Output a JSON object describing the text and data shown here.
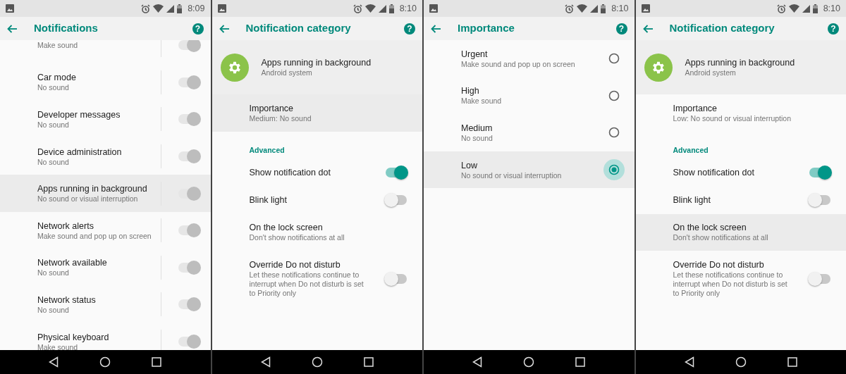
{
  "screens": [
    {
      "status_bar": {
        "time": "8:09"
      },
      "app_bar": {
        "title": "Notifications",
        "help": "?"
      },
      "items": [
        {
          "kind": "split_switch",
          "subtitle": "Make sound",
          "on": true,
          "disabled": true,
          "selected": false
        },
        {
          "kind": "split_switch",
          "title": "Car mode",
          "subtitle": "No sound",
          "on": true,
          "disabled": true,
          "selected": false
        },
        {
          "kind": "split_switch",
          "title": "Developer messages",
          "subtitle": "No sound",
          "on": true,
          "disabled": true,
          "selected": false
        },
        {
          "kind": "split_switch",
          "title": "Device administration",
          "subtitle": "No sound",
          "on": true,
          "disabled": true,
          "selected": false
        },
        {
          "kind": "split_switch",
          "title": "Apps running in background",
          "subtitle": "No sound or visual interruption",
          "on": true,
          "disabled": true,
          "selected": true
        },
        {
          "kind": "split_switch",
          "title": "Network alerts",
          "subtitle": "Make sound and pop up on screen",
          "on": true,
          "disabled": true,
          "selected": false
        },
        {
          "kind": "split_switch",
          "title": "Network available",
          "subtitle": "No sound",
          "on": true,
          "disabled": true,
          "selected": false
        },
        {
          "kind": "split_switch",
          "title": "Network status",
          "subtitle": "No sound",
          "on": true,
          "disabled": true,
          "selected": false
        },
        {
          "kind": "split_switch",
          "title": "Physical keyboard",
          "subtitle": "Make sound",
          "on": true,
          "disabled": true,
          "selected": false
        }
      ]
    },
    {
      "status_bar": {
        "time": "8:10"
      },
      "app_bar": {
        "title": "Notification category",
        "help": "?"
      },
      "header": {
        "title": "Apps running in background",
        "subtitle": "Android system"
      },
      "items": [
        {
          "kind": "text",
          "title": "Importance",
          "subtitle": "Medium: No sound",
          "selected": true
        },
        {
          "kind": "section",
          "title": "Advanced"
        },
        {
          "kind": "switch",
          "title": "Show notification dot",
          "on": true,
          "disabled": false,
          "selected": false
        },
        {
          "kind": "switch",
          "title": "Blink light",
          "on": false,
          "disabled": false,
          "selected": false
        },
        {
          "kind": "text",
          "title": "On the lock screen",
          "subtitle": "Don't show notifications at all",
          "selected": false
        },
        {
          "kind": "switch",
          "title": "Override Do not disturb",
          "subtitle": "Let these notifications continue to interrupt when Do not disturb is set to Priority only",
          "on": false,
          "disabled": false,
          "selected": false
        }
      ]
    },
    {
      "status_bar": {
        "time": "8:10"
      },
      "app_bar": {
        "title": "Importance",
        "help": "?"
      },
      "items": [
        {
          "kind": "radio",
          "title": "Urgent",
          "subtitle": "Make sound and pop up on screen",
          "selected": false
        },
        {
          "kind": "radio",
          "title": "High",
          "subtitle": "Make sound",
          "selected": false
        },
        {
          "kind": "radio",
          "title": "Medium",
          "subtitle": "No sound",
          "selected": false
        },
        {
          "kind": "radio",
          "title": "Low",
          "subtitle": "No sound or visual interruption",
          "selected": true
        }
      ]
    },
    {
      "status_bar": {
        "time": "8:10"
      },
      "app_bar": {
        "title": "Notification category",
        "help": "?"
      },
      "header": {
        "title": "Apps running in background",
        "subtitle": "Android system"
      },
      "items": [
        {
          "kind": "text",
          "title": "Importance",
          "subtitle": "Low: No sound or visual interruption",
          "selected": false
        },
        {
          "kind": "section",
          "title": "Advanced"
        },
        {
          "kind": "switch",
          "title": "Show notification dot",
          "on": true,
          "disabled": false,
          "selected": false
        },
        {
          "kind": "switch",
          "title": "Blink light",
          "on": false,
          "disabled": false,
          "selected": false
        },
        {
          "kind": "text",
          "title": "On the lock screen",
          "subtitle": "Don't show notifications at all",
          "selected": true
        },
        {
          "kind": "switch",
          "title": "Override Do not disturb",
          "subtitle": "Let these notifications continue to interrupt when Do not disturb is set to Priority only",
          "on": false,
          "disabled": false,
          "selected": false
        }
      ]
    }
  ]
}
